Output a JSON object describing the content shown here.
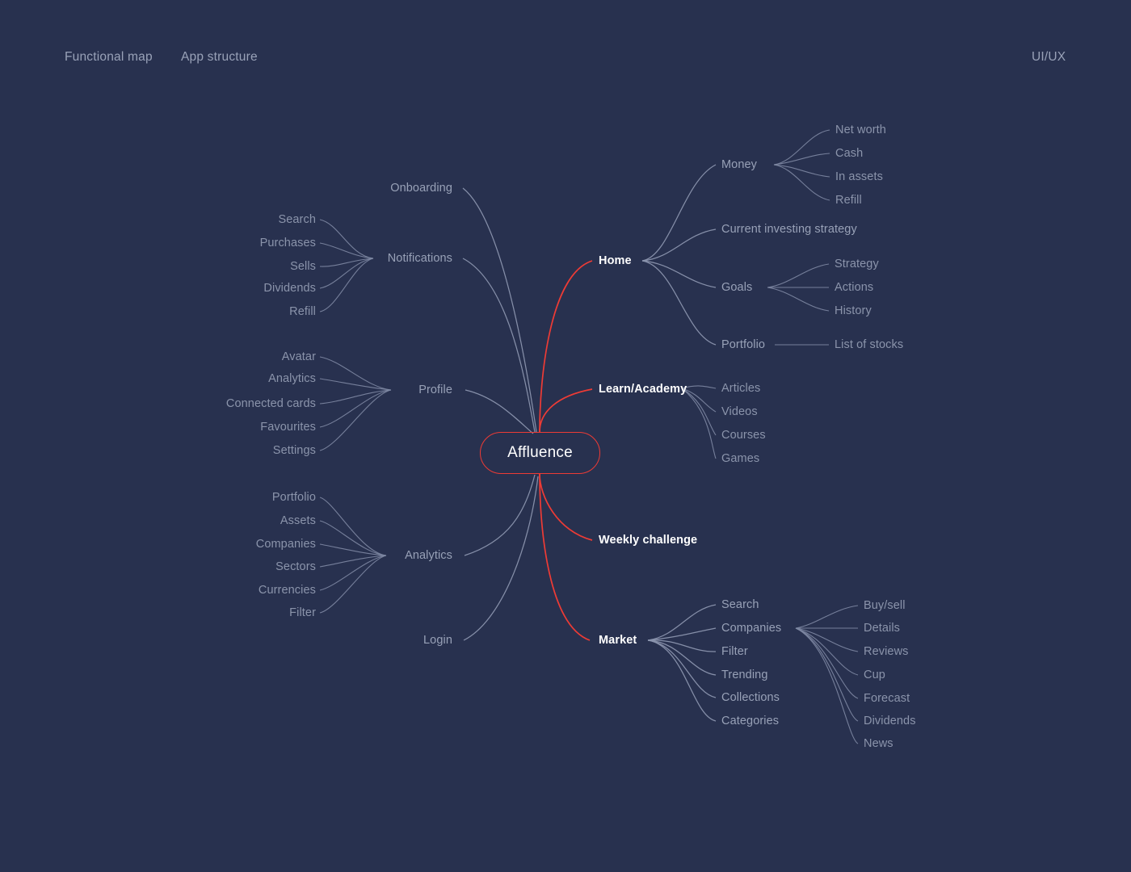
{
  "meta": {
    "page_title": "Functional map",
    "background_color": "#28314f",
    "accent_color": "#ee3b35",
    "edge_color": "#8b95ae",
    "level1_text_color": "#ffffff",
    "level2_text_color": "#98a1b7",
    "level3_text_color": "#8b94ab"
  },
  "header": {
    "links": [
      {
        "label": "Functional map"
      },
      {
        "label": "App structure"
      }
    ],
    "right_label": "UI/UX"
  },
  "root": {
    "label": "Affluence"
  },
  "branches": {
    "home": {
      "label": "Home",
      "children": [
        {
          "label": "Money",
          "children": [
            "Net worth",
            "Cash",
            "In assets",
            "Refill"
          ]
        },
        {
          "label": "Current investing strategy",
          "children": []
        },
        {
          "label": "Goals",
          "children": [
            "Strategy",
            "Actions",
            "History"
          ]
        },
        {
          "label": "Portfolio",
          "children": [
            "List of stocks"
          ]
        }
      ]
    },
    "learn": {
      "label": "Learn/Academy",
      "children": [
        {
          "label": "Articles",
          "children": []
        },
        {
          "label": "Videos",
          "children": []
        },
        {
          "label": "Courses",
          "children": []
        },
        {
          "label": "Games",
          "children": []
        }
      ]
    },
    "weekly": {
      "label": "Weekly challenge",
      "children": []
    },
    "market": {
      "label": "Market",
      "children": [
        {
          "label": "Search",
          "children": []
        },
        {
          "label": "Companies",
          "children": [
            "Buy/sell",
            "Details",
            "Reviews",
            "Cup",
            "Forecast",
            "Dividends",
            "News"
          ]
        },
        {
          "label": "Filter",
          "children": []
        },
        {
          "label": "Trending",
          "children": []
        },
        {
          "label": "Collections",
          "children": []
        },
        {
          "label": "Categories",
          "children": []
        }
      ]
    },
    "onboarding": {
      "label": "Onboarding",
      "children": []
    },
    "notifications": {
      "label": "Notifications",
      "children": [
        "Search",
        "Purchases",
        "Sells",
        "Dividends",
        "Refill"
      ]
    },
    "profile": {
      "label": "Profile",
      "children": [
        "Avatar",
        "Analytics",
        "Connected cards",
        "Favourites",
        "Settings"
      ]
    },
    "analytics": {
      "label": "Analytics",
      "children": [
        "Portfolio",
        "Assets",
        "Companies",
        "Sectors",
        "Currencies",
        "Filter"
      ]
    },
    "login": {
      "label": "Login",
      "children": []
    }
  }
}
